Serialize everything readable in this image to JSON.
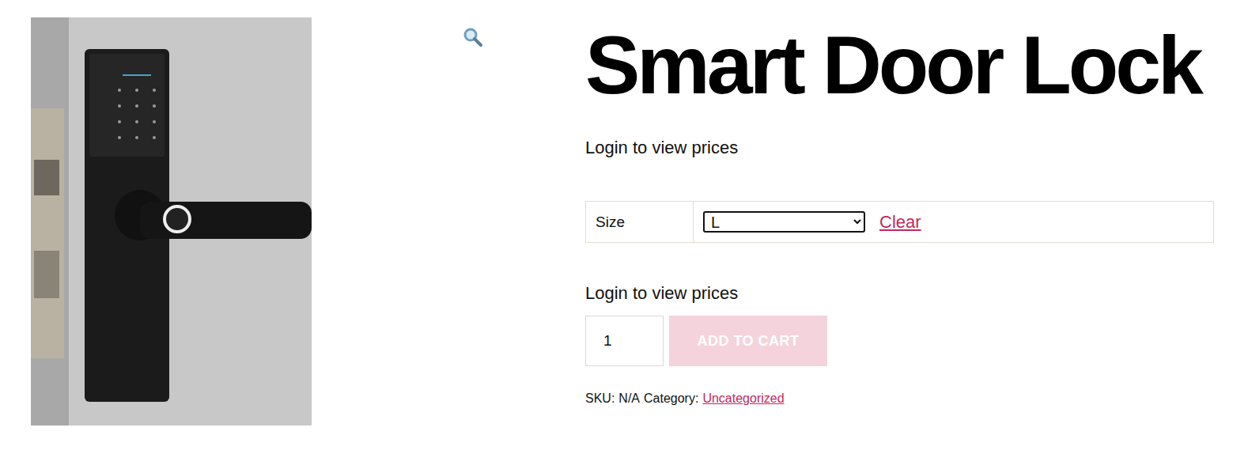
{
  "title": "Smart Door Lock",
  "price_notice": "Login to view prices",
  "variations": [
    {
      "label": "Size",
      "value": "L",
      "clear": "Clear"
    }
  ],
  "cart": {
    "price_notice": "Login to view prices",
    "quantity": "1",
    "button": "ADD TO CART",
    "disabled": true
  },
  "meta": {
    "sku_label": "SKU:",
    "sku": "N/A",
    "category_label": "Category:",
    "category": "Uncategorized"
  }
}
